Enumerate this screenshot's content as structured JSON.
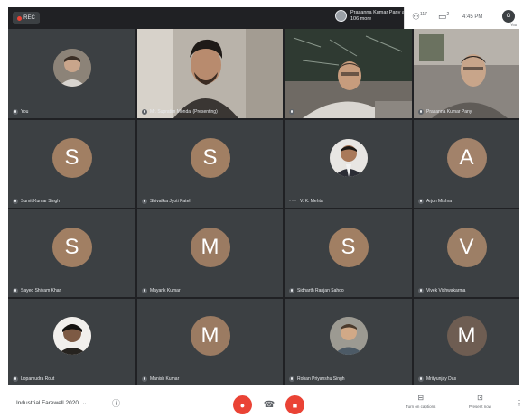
{
  "topbar": {
    "rec_label": "REC",
    "presenter_text": "Prasanna Kumar Pany and 106 more",
    "people_count": "117",
    "chat_count": "2",
    "time": "4:45 PM",
    "me_initial": "G",
    "you_label": "You"
  },
  "tiles": [
    {
      "name": "You",
      "type": "photo"
    },
    {
      "name": "Mr. Supratim Mondal (Presenting)",
      "type": "video"
    },
    {
      "name": "",
      "type": "video"
    },
    {
      "name": "Prasanna Kumar Pany",
      "type": "video"
    },
    {
      "name": "Sumit Kumar Singh",
      "type": "initial",
      "initial": "S",
      "color": "#a17f63"
    },
    {
      "name": "Shivalika Jyoti Patel",
      "type": "initial",
      "initial": "S",
      "color": "#a17f63"
    },
    {
      "name": "V. K. Mehta",
      "type": "photo"
    },
    {
      "name": "Arjun Mishra",
      "type": "initial",
      "initial": "A",
      "color": "#a2826a"
    },
    {
      "name": "Sayed Shivam Khan",
      "type": "initial",
      "initial": "S",
      "color": "#a17f63"
    },
    {
      "name": "Mayank Kumar",
      "type": "initial",
      "initial": "M",
      "color": "#9b7b62"
    },
    {
      "name": "Sidharth Ranjan Sahoo",
      "type": "initial",
      "initial": "S",
      "color": "#a17f63"
    },
    {
      "name": "Vivek Vishwakarma",
      "type": "initial",
      "initial": "V",
      "color": "#9d7f66"
    },
    {
      "name": "Lopamudra Rout",
      "type": "photo"
    },
    {
      "name": "Manish Kumar",
      "type": "initial",
      "initial": "M",
      "color": "#9b7b62"
    },
    {
      "name": "Rohan Priyanshu Singh",
      "type": "photo"
    },
    {
      "name": "Mrityunjay Das",
      "type": "initial",
      "initial": "M",
      "color": "#6e5d52"
    }
  ],
  "bottombar": {
    "meeting_name": "Industrial Farewell 2020",
    "caption_label": "Turn on captions",
    "present_label": "Present now"
  }
}
